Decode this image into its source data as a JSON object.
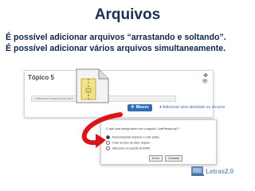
{
  "title": "Arquivos",
  "lines": [
    "É possível adicionar arquivos “arrastando e soltando”.",
    "É possível adicionar vários arquivos simultaneamente."
  ],
  "card": {
    "topic": "Tópico 5",
    "add_field": "Adicionar arquivos(s) aqui",
    "move_button": "Mover",
    "add_activity": "Adicionar uma atividade ou recurso",
    "icons": [
      "move-icon",
      "eye-icon",
      "file-icon"
    ]
  },
  "dialog": {
    "question": "O que você deseja fazer com o arquivo \"LinkPessoa.zip\"?",
    "options": [
      "Descompactar arquivos e criar pasta",
      "Criar recurso de fazer arquivo",
      "Adicionar um pacote SCORM"
    ],
    "selected_index": 0,
    "ok_label": "Envio",
    "cancel_label": "Cancelar"
  },
  "logo": {
    "text": "Letras2.0",
    "icon": "laptop-icon"
  },
  "colors": {
    "title": "#1b2f4e",
    "text": "#0d2547",
    "button": "#2f6db3",
    "arrow": "#d9141b",
    "logo": "#6f93bb"
  }
}
